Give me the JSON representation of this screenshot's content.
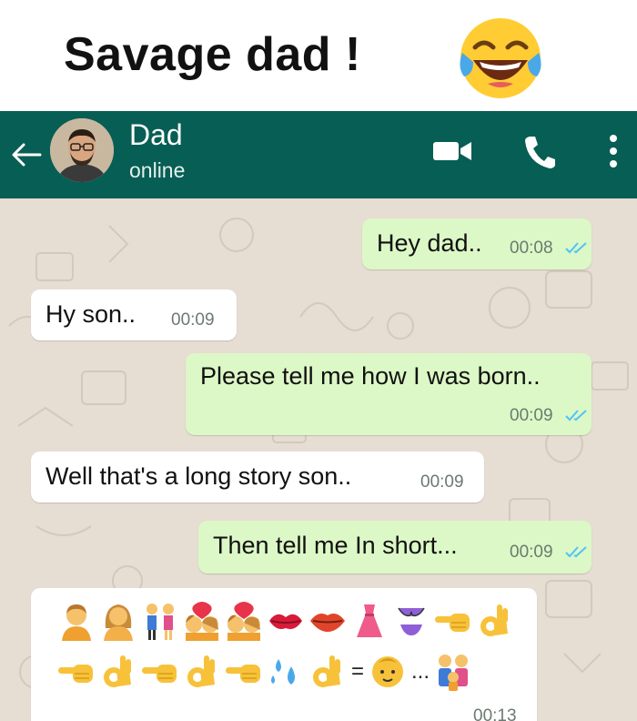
{
  "caption": {
    "title": "Savage dad !",
    "emoji": "face-with-tears-of-joy-emoji"
  },
  "header": {
    "contact_name": "Dad",
    "status": "online",
    "icons": [
      "back-arrow-icon",
      "video-call-icon",
      "phone-call-icon",
      "more-options-icon"
    ],
    "bar_color": "#075e54"
  },
  "messages": [
    {
      "direction": "out",
      "text": "Hey dad..",
      "time": "00:08",
      "read": true
    },
    {
      "direction": "in",
      "text": "Hy son..",
      "time": "00:09"
    },
    {
      "direction": "out",
      "text": "Please tell me how I was born..",
      "time": "00:09",
      "read": true
    },
    {
      "direction": "in",
      "text": "Well that's a long story son..",
      "time": "00:09"
    },
    {
      "direction": "out",
      "text": "Then tell me In short...",
      "time": "00:09",
      "read": true
    },
    {
      "direction": "in",
      "time": "00:13",
      "emoji_line_1": [
        "man",
        "woman",
        "couple-holding-hands",
        "kiss-couple",
        "kiss-couple",
        "kiss-mark",
        "lips",
        "dress",
        "bikini",
        "pointing-left-hand",
        "ok-hand"
      ],
      "emoji_line_2": [
        "pointing-left-hand",
        "ok-hand",
        "pointing-left-hand",
        "ok-hand",
        "pointing-left-hand",
        "sweat-droplets",
        "ok-hand",
        "equals",
        "baby",
        "ellipsis",
        "family"
      ],
      "equals_text": "=",
      "ellipsis_text": "..."
    }
  ],
  "colors": {
    "outgoing_bubble": "#dcf8c6",
    "incoming_bubble": "#ffffff",
    "chat_background": "#e6ddd3",
    "read_ticks": "#4fc3f7"
  }
}
